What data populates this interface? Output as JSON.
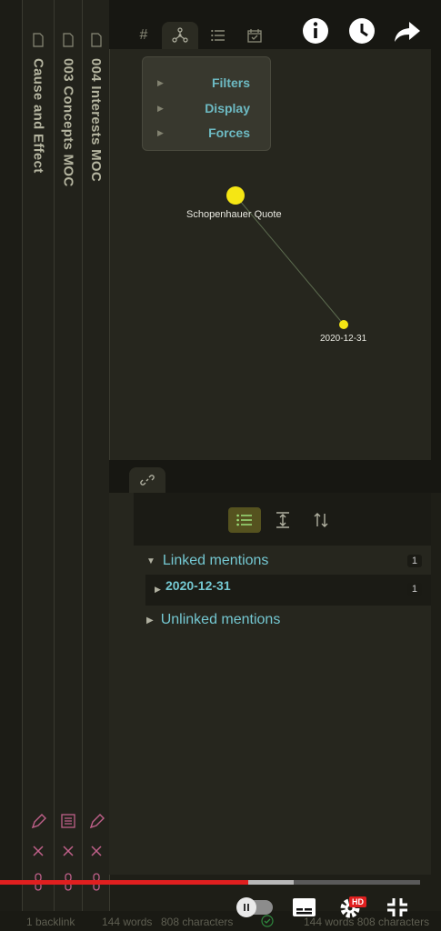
{
  "left_panes": [
    {
      "title": "Cause and Effect"
    },
    {
      "title": "003 Concepts MOC"
    },
    {
      "title": "004 Interests MOC"
    }
  ],
  "tabs": [
    "tags-tab",
    "graph-tab",
    "outline-tab",
    "calendar-tab"
  ],
  "graph": {
    "controls": {
      "filters": "Filters",
      "display": "Display",
      "forces": "Forces"
    },
    "nodes": [
      {
        "label": "Schopenhauer Quote",
        "color": "#f5e614"
      },
      {
        "label": "2020-12-31",
        "color": "#f5e614"
      }
    ],
    "link_color": "#5c6b4f"
  },
  "backlinks": {
    "linked_label": "Linked mentions",
    "linked_count": "1",
    "match_title": "2020-12-31",
    "match_count": "1",
    "unlinked_label": "Unlinked mentions"
  },
  "status": {
    "backlinks": "1 backlink",
    "words1": "144 words",
    "chars1": "808 characters",
    "words_chars2": "144 words 808 characters"
  },
  "video": {
    "progress_played": 0.59,
    "progress_buffered": 0.7,
    "hd_badge": "HD"
  },
  "colors": {
    "accent": "#74c7d1",
    "progress": "#e01f1f",
    "pink_icon": "#c0608a"
  }
}
